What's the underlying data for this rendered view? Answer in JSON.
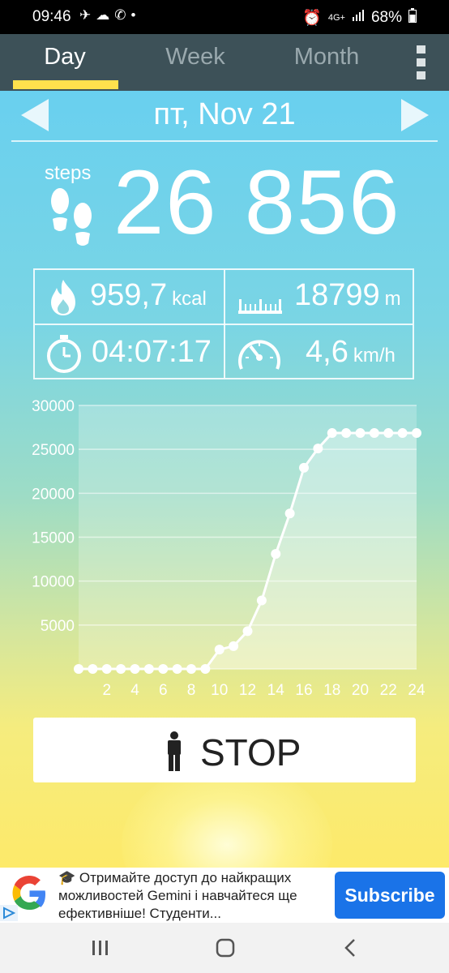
{
  "status_bar": {
    "time": "09:46",
    "battery": "68%",
    "network": "4G+"
  },
  "tabs": [
    {
      "label": "Day",
      "active": true
    },
    {
      "label": "Week",
      "active": false
    },
    {
      "label": "Month",
      "active": false
    }
  ],
  "date_nav": {
    "date": "пт, Nov 21"
  },
  "steps": {
    "label": "steps",
    "value": "26 856"
  },
  "stats": {
    "calories": {
      "value": "959,7",
      "unit": "kcal"
    },
    "distance": {
      "value": "18799",
      "unit": "m"
    },
    "duration": {
      "value": "04:07:17"
    },
    "speed": {
      "value": "4,6",
      "unit": "km/h"
    }
  },
  "colors": {
    "tab_bar": "#3d5158",
    "tab_underline": "#ffe14d",
    "ad_button": "#1a73e8"
  },
  "chart_data": {
    "type": "area",
    "x": [
      0,
      1,
      2,
      3,
      4,
      5,
      6,
      7,
      8,
      9,
      10,
      11,
      12,
      13,
      14,
      15,
      16,
      17,
      18,
      19,
      20,
      21,
      22,
      23,
      24
    ],
    "values": [
      0,
      0,
      0,
      0,
      0,
      0,
      0,
      0,
      0,
      0,
      2200,
      2600,
      4300,
      7800,
      13100,
      17700,
      22900,
      25100,
      26856,
      26856,
      26856,
      26856,
      26856,
      26856,
      26856
    ],
    "x_tick_labels": [
      "2",
      "4",
      "6",
      "8",
      "10",
      "12",
      "14",
      "16",
      "18",
      "20",
      "22",
      "24"
    ],
    "y_tick_labels": [
      "30000",
      "25000",
      "20000",
      "15000",
      "10000",
      "5000"
    ],
    "ylim": [
      0,
      30000
    ],
    "xlim": [
      0,
      24
    ],
    "grid": true
  },
  "stop_button": {
    "label": "STOP"
  },
  "ad": {
    "text": "🎓 Отримайте доступ до найкращих можливостей Gemini і навчайтеся ще ефективніше! Студенти...",
    "button_label": "Subscribe"
  }
}
